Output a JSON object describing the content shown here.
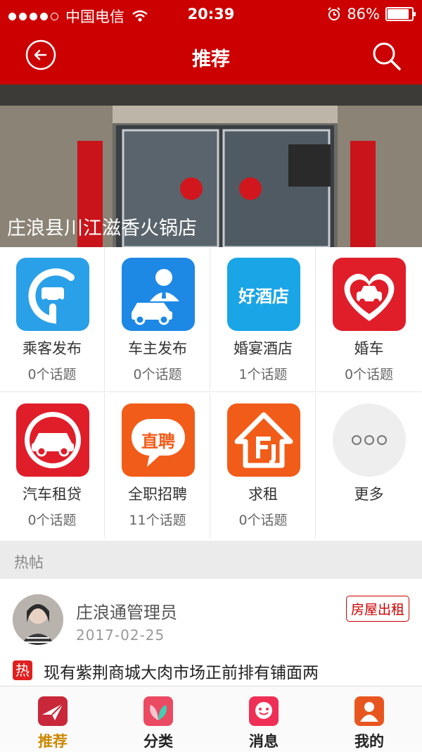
{
  "status_bar": {
    "carrier": "中国电信",
    "time": "20:39",
    "battery": "86%"
  },
  "nav": {
    "title": "推荐"
  },
  "banner": {
    "caption": "庄浪县川江滋香火锅店"
  },
  "categories": [
    {
      "name": "乘客发布",
      "count": "0个话题",
      "icon": "passenger-car-pin-icon",
      "color": "#2aa0e8"
    },
    {
      "name": "车主发布",
      "count": "0个话题",
      "icon": "driver-car-icon",
      "color": "#1e88e5"
    },
    {
      "name": "婚宴酒店",
      "count": "1个话题",
      "icon": "good-hotel-icon",
      "color": "#1aa5e6",
      "icon_text": "好酒店"
    },
    {
      "name": "婚车",
      "count": "0个话题",
      "icon": "heart-car-icon",
      "color": "#e01e2a"
    },
    {
      "name": "汽车租贷",
      "count": "0个话题",
      "icon": "car-rental-icon",
      "color": "#e01e2a"
    },
    {
      "name": "全职招聘",
      "count": "11个话题",
      "icon": "recruit-bubble-icon",
      "color": "#f25c19",
      "icon_text": "直聘"
    },
    {
      "name": "求租",
      "count": "0个话题",
      "icon": "house-rent-icon",
      "color": "#f25c19"
    },
    {
      "name": "更多",
      "count": "",
      "icon": "more-dots-icon",
      "color": "#eeeeee"
    }
  ],
  "section": {
    "title": "热帖"
  },
  "post": {
    "author": "庄浪通管理员",
    "date": "2017-02-25",
    "tag": "房屋出租",
    "hot_label": "热",
    "text": "现有紫荆商城大肉市场正前排有铺面两"
  },
  "tabs": [
    {
      "label": "推荐",
      "icon": "recommend-plane-icon",
      "active": true
    },
    {
      "label": "分类",
      "icon": "category-leaf-icon",
      "active": false
    },
    {
      "label": "消息",
      "icon": "message-smile-icon",
      "active": false
    },
    {
      "label": "我的",
      "icon": "profile-user-icon",
      "active": false
    }
  ],
  "colors": {
    "brand_red": "#cc0000",
    "active_tab": "#cc8800"
  }
}
